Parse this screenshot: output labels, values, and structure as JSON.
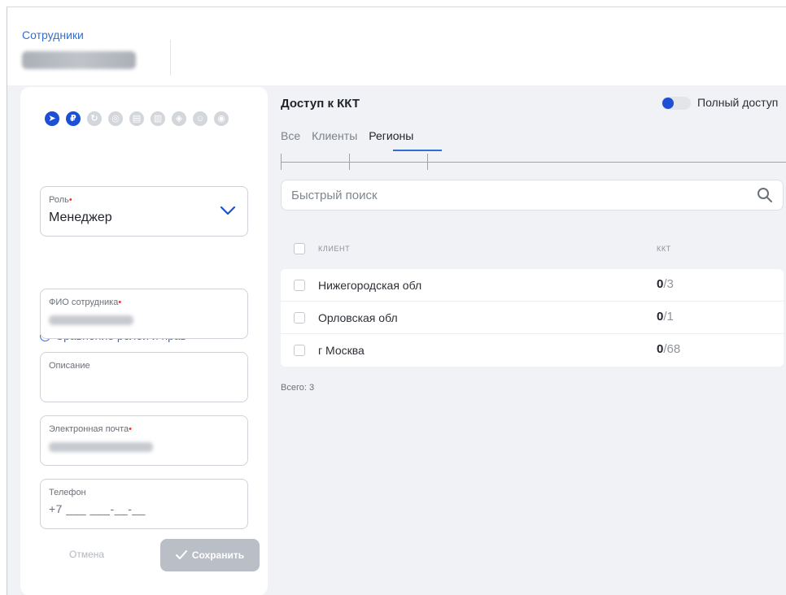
{
  "header": {
    "breadcrumb": "Сотрудники"
  },
  "left_panel": {
    "permission_icons": [
      {
        "name": "send-icon",
        "glyph": "➤",
        "active": true
      },
      {
        "name": "ruble-icon",
        "glyph": "₽",
        "active": true
      },
      {
        "name": "refresh-icon",
        "glyph": "↻",
        "active": false
      },
      {
        "name": "settings-icon",
        "glyph": "◎",
        "active": false
      },
      {
        "name": "document-icon",
        "glyph": "▤",
        "active": false
      },
      {
        "name": "report-icon",
        "glyph": "▥",
        "active": false
      },
      {
        "name": "shield-icon",
        "glyph": "◈",
        "active": false
      },
      {
        "name": "user-icon",
        "glyph": "☺",
        "active": false
      },
      {
        "name": "camera-icon",
        "glyph": "◉",
        "active": false
      }
    ],
    "role": {
      "label": "Роль",
      "value": "Менеджер"
    },
    "compare_link": "Сравнение ролей и прав",
    "fio": {
      "label": "ФИО сотрудника"
    },
    "description": {
      "label": "Описание"
    },
    "email": {
      "label": "Электронная почта"
    },
    "phone": {
      "label": "Телефон",
      "value": "+7 ___ ___-__-__"
    },
    "cancel_label": "Отмена",
    "save_label": "Сохранить"
  },
  "right_panel": {
    "title": "Доступ к ККТ",
    "toggle_label": "Полный доступ",
    "toggle_on": true,
    "tabs": [
      {
        "label": "Все",
        "active": false
      },
      {
        "label": "Клиенты",
        "active": false
      },
      {
        "label": "Регионы",
        "active": true
      }
    ],
    "search_placeholder": "Быстрый поиск",
    "columns": {
      "client": "КЛИЕНТ",
      "kkt": "ККТ"
    },
    "rows": [
      {
        "name": "Нижегородская обл",
        "kkt_selected": "0",
        "kkt_total": "/3"
      },
      {
        "name": "Орловская обл",
        "kkt_selected": "0",
        "kkt_total": "/1"
      },
      {
        "name": "г Москва",
        "kkt_selected": "0",
        "kkt_total": "/68"
      }
    ],
    "total": "Всего: 3"
  },
  "colors": {
    "accent": "#1d4fd6",
    "link": "#2f6fd6",
    "required": "#e2372d",
    "background": "#f1f2f5"
  }
}
